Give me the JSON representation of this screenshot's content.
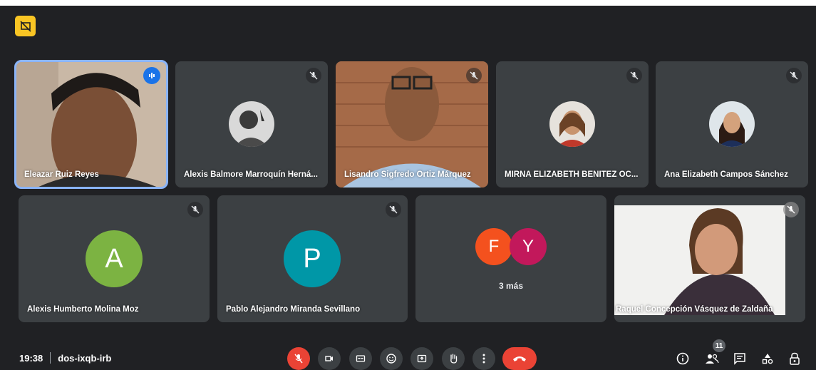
{
  "meeting": {
    "time": "19:38",
    "code": "dos-ixqb-irb"
  },
  "participants_count": "11",
  "tiles": [
    {
      "name": "Eleazar Ruiz Reyes"
    },
    {
      "name": "Alexis Balmore Marroquín Herná..."
    },
    {
      "name": "Lisandro Sigfredo Ortiz Márquez"
    },
    {
      "name": "MIRNA ELIZABETH BENITEZ OC..."
    },
    {
      "name": "Ana Elizabeth Campos Sánchez"
    },
    {
      "name": "Alexis Humberto Molina Moz",
      "initial": "A",
      "color": "#7cb342"
    },
    {
      "name": "Pablo Alejandro Miranda Sevillano",
      "initial": "P",
      "color": "#0097a7"
    },
    {
      "name": "",
      "initials": [
        "F",
        "Y"
      ],
      "colors": [
        "#f4511e",
        "#c2185b"
      ],
      "more": "3 más"
    },
    {
      "name": "Raquel Concepción Vásquez de Zaldaña"
    }
  ],
  "colors": {
    "background": "#202124",
    "tile": "#3c4043",
    "accent": "#1a73e8",
    "danger": "#ea4335",
    "badge": "#f9c524"
  }
}
